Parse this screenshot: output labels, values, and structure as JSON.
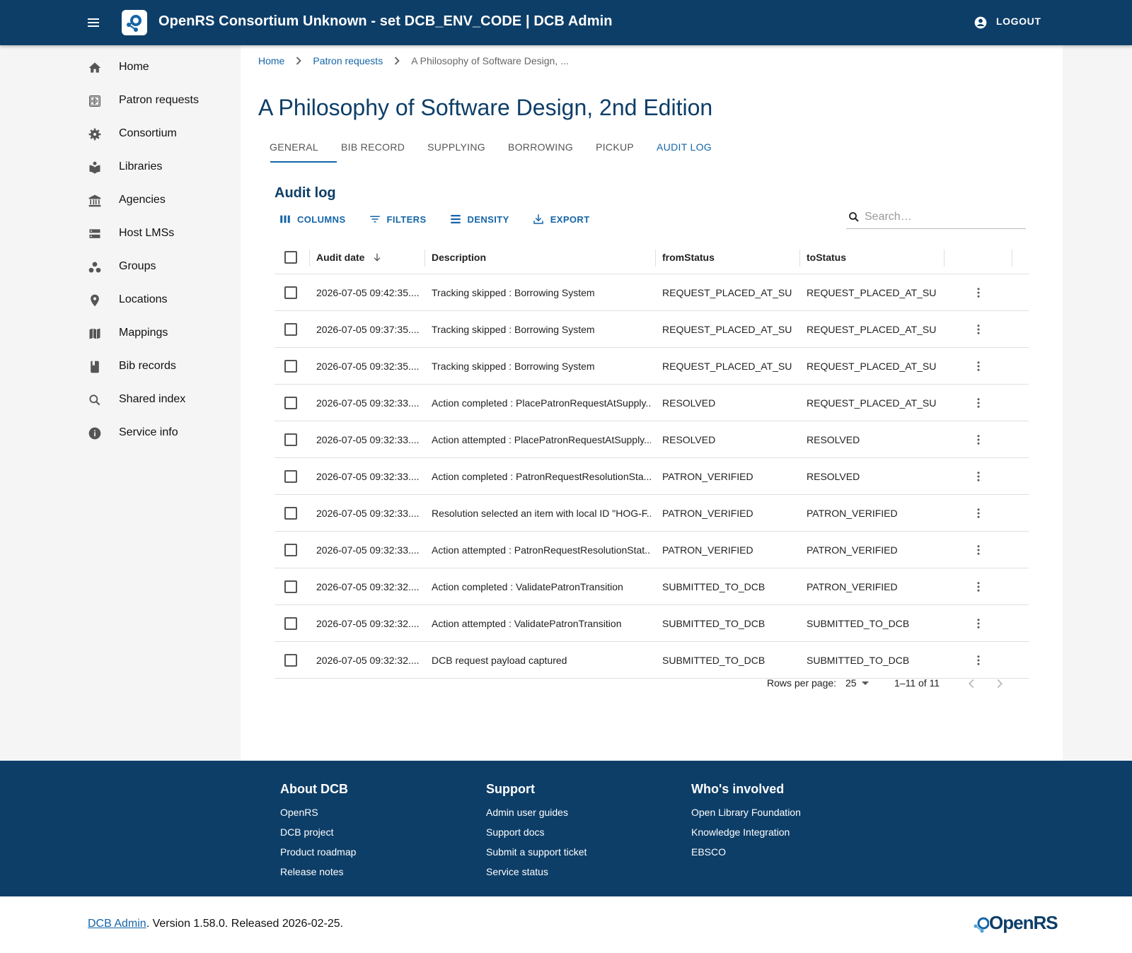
{
  "header": {
    "title": "OpenRS Consortium Unknown - set DCB_ENV_CODE | DCB Admin",
    "logout_label": "LOGOUT"
  },
  "sidebar": {
    "items": [
      {
        "label": "Home",
        "icon": "home-icon"
      },
      {
        "label": "Patron requests",
        "icon": "exit-to-app-icon"
      },
      {
        "label": "Consortium",
        "icon": "gear-icon"
      },
      {
        "label": "Libraries",
        "icon": "library-icon"
      },
      {
        "label": "Agencies",
        "icon": "bank-icon"
      },
      {
        "label": "Host LMSs",
        "icon": "storage-icon"
      },
      {
        "label": "Groups",
        "icon": "workspaces-icon"
      },
      {
        "label": "Locations",
        "icon": "location-pin-icon"
      },
      {
        "label": "Mappings",
        "icon": "map-icon"
      },
      {
        "label": "Bib records",
        "icon": "book-icon"
      },
      {
        "label": "Shared index",
        "icon": "search-icon"
      },
      {
        "label": "Service info",
        "icon": "info-icon"
      }
    ]
  },
  "breadcrumb": {
    "home": "Home",
    "patron_requests": "Patron requests",
    "current": "A Philosophy of Software Design, ..."
  },
  "page": {
    "title": "A Philosophy of Software Design, 2nd Edition"
  },
  "tabs": [
    "GENERAL",
    "BIB RECORD",
    "SUPPLYING",
    "BORROWING",
    "PICKUP",
    "AUDIT LOG"
  ],
  "audit": {
    "title": "Audit log",
    "toolbar": {
      "columns": "COLUMNS",
      "filters": "FILTERS",
      "density": "DENSITY",
      "export": "EXPORT"
    },
    "search_placeholder": "Search…",
    "columns": {
      "date": "Audit date",
      "description": "Description",
      "from": "fromStatus",
      "to": "toStatus"
    },
    "rows": [
      {
        "date": "2026-07-05 09:42:35....",
        "description": "Tracking skipped : Borrowing System",
        "from": "REQUEST_PLACED_AT_SUP...",
        "to": "REQUEST_PLACED_AT_SUP..."
      },
      {
        "date": "2026-07-05 09:37:35....",
        "description": "Tracking skipped : Borrowing System",
        "from": "REQUEST_PLACED_AT_SUP...",
        "to": "REQUEST_PLACED_AT_SUP..."
      },
      {
        "date": "2026-07-05 09:32:35....",
        "description": "Tracking skipped : Borrowing System",
        "from": "REQUEST_PLACED_AT_SUP...",
        "to": "REQUEST_PLACED_AT_SUP..."
      },
      {
        "date": "2026-07-05 09:32:33....",
        "description": "Action completed : PlacePatronRequestAtSupply...",
        "from": "RESOLVED",
        "to": "REQUEST_PLACED_AT_SUP..."
      },
      {
        "date": "2026-07-05 09:32:33....",
        "description": "Action attempted : PlacePatronRequestAtSupply...",
        "from": "RESOLVED",
        "to": "RESOLVED"
      },
      {
        "date": "2026-07-05 09:32:33....",
        "description": "Action completed : PatronRequestResolutionSta...",
        "from": "PATRON_VERIFIED",
        "to": "RESOLVED"
      },
      {
        "date": "2026-07-05 09:32:33....",
        "description": "Resolution selected an item with local ID \"HOG-F...",
        "from": "PATRON_VERIFIED",
        "to": "PATRON_VERIFIED"
      },
      {
        "date": "2026-07-05 09:32:33....",
        "description": "Action attempted : PatronRequestResolutionStat...",
        "from": "PATRON_VERIFIED",
        "to": "PATRON_VERIFIED"
      },
      {
        "date": "2026-07-05 09:32:32....",
        "description": "Action completed : ValidatePatronTransition",
        "from": "SUBMITTED_TO_DCB",
        "to": "PATRON_VERIFIED"
      },
      {
        "date": "2026-07-05 09:32:32....",
        "description": "Action attempted : ValidatePatronTransition",
        "from": "SUBMITTED_TO_DCB",
        "to": "SUBMITTED_TO_DCB"
      },
      {
        "date": "2026-07-05 09:32:32....",
        "description": "DCB request payload captured",
        "from": "SUBMITTED_TO_DCB",
        "to": "SUBMITTED_TO_DCB"
      }
    ],
    "pager": {
      "rows_per_page_label": "Rows per page:",
      "rows_per_page": "25",
      "range": "1–11 of 11"
    }
  },
  "footer": {
    "about": {
      "title": "About DCB",
      "links": [
        "OpenRS",
        "DCB project",
        "Product roadmap",
        "Release notes"
      ]
    },
    "support": {
      "title": "Support",
      "links": [
        "Admin user guides",
        "Support docs",
        "Submit a support ticket",
        "Service status"
      ]
    },
    "involved": {
      "title": "Who's involved",
      "links": [
        "Open Library Foundation",
        "Knowledge Integration",
        "EBSCO"
      ]
    }
  },
  "bottom": {
    "app_link": "DCB Admin",
    "version_text": ". Version 1.58.0. Released 2026-02-25.",
    "logo_text": "OpenRS"
  },
  "colors": {
    "brand": "#0d3e68",
    "accent": "#1565a8"
  }
}
